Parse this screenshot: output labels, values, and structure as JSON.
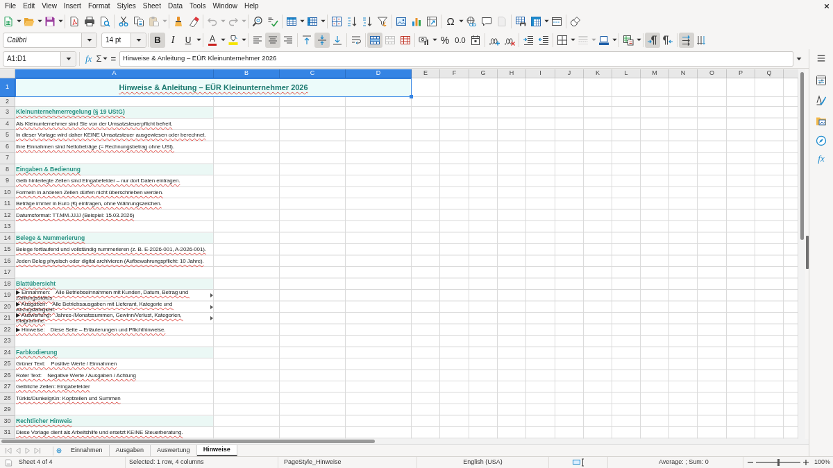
{
  "menu_bar": {
    "items": [
      "File",
      "Edit",
      "View",
      "Insert",
      "Format",
      "Styles",
      "Sheet",
      "Data",
      "Tools",
      "Window",
      "Help"
    ]
  },
  "standard_toolbar": {
    "buttons": [
      {
        "disabled": false
      },
      {
        "disabled": false
      },
      {
        "disabled": false
      },
      {
        "disabled": false
      },
      {
        "disabled": false
      },
      {
        "disabled": false
      },
      {
        "disabled": false
      },
      {
        "disabled": false
      },
      {
        "disabled": true
      },
      {
        "disabled": false
      },
      {
        "disabled": false
      },
      {
        "disabled": true
      },
      {
        "disabled": true
      },
      {
        "disabled": false
      },
      {
        "disabled": false
      },
      {
        "disabled": false
      },
      {
        "disabled": false
      },
      {
        "disabled": false
      },
      {
        "disabled": false
      },
      {
        "disabled": false
      },
      {
        "disabled": false
      },
      {
        "disabled": false
      },
      {
        "disabled": false
      },
      {
        "disabled": false
      },
      {
        "label": "Ω",
        "disabled": false
      },
      {
        "disabled": false
      },
      {
        "disabled": false
      },
      {
        "disabled": true
      },
      {
        "disabled": false
      },
      {
        "disabled": false
      },
      {
        "disabled": false
      },
      {
        "disabled": false
      }
    ]
  },
  "formatting_toolbar": {
    "font_name": "Calibri",
    "font_size": "14 pt",
    "buttons": [
      {
        "label": "B",
        "pressed": true,
        "disabled": false
      },
      {
        "label": "I",
        "pressed": false,
        "disabled": false
      },
      {
        "label": "U",
        "pressed": false,
        "disabled": false
      },
      {
        "label": "A",
        "pressed": false,
        "disabled": false
      },
      {
        "pressed": false,
        "disabled": false
      },
      {
        "pressed": false,
        "disabled": false
      },
      {
        "pressed": true,
        "disabled": false
      },
      {
        "pressed": false,
        "disabled": false
      },
      {
        "pressed": false,
        "disabled": false
      },
      {
        "pressed": true,
        "disabled": false
      },
      {
        "pressed": false,
        "disabled": false
      },
      {
        "pressed": false,
        "disabled": false
      },
      {
        "pressed": true,
        "disabled": false
      },
      {
        "pressed": false,
        "disabled": true
      },
      {
        "pressed": false,
        "disabled": false
      },
      {
        "pressed": false,
        "disabled": false
      },
      {
        "label": "%",
        "pressed": false,
        "disabled": false
      },
      {
        "label": "0.0",
        "pressed": false,
        "disabled": false
      },
      {
        "pressed": false,
        "disabled": false
      },
      {
        "pressed": false,
        "disabled": false
      },
      {
        "pressed": false,
        "disabled": false
      },
      {
        "pressed": false,
        "disabled": false
      },
      {
        "pressed": false,
        "disabled": false
      },
      {
        "pressed": false,
        "disabled": false
      },
      {
        "pressed": false,
        "disabled": true
      },
      {
        "pressed": false,
        "disabled": false
      },
      {
        "pressed": false,
        "disabled": false
      },
      {
        "pressed": true,
        "disabled": false
      },
      {
        "pressed": false,
        "disabled": false
      },
      {
        "pressed": true,
        "disabled": false
      },
      {
        "pressed": false,
        "disabled": false
      }
    ]
  },
  "formula_bar": {
    "name_box": "A1:D1",
    "function_wizard": "fx",
    "sum": "Σ",
    "equals": "=",
    "content": "Hinweise & Anleitung – EÜR Kleinunternehmer 2026"
  },
  "sheet": {
    "columns": [
      {
        "label": "A",
        "selected": true
      },
      {
        "label": "B",
        "selected": true
      },
      {
        "label": "C",
        "selected": true
      },
      {
        "label": "D",
        "selected": true
      },
      {
        "label": "E",
        "selected": false
      },
      {
        "label": "F",
        "selected": false
      },
      {
        "label": "G",
        "selected": false
      },
      {
        "label": "H",
        "selected": false
      },
      {
        "label": "I",
        "selected": false
      },
      {
        "label": "J",
        "selected": false
      },
      {
        "label": "K",
        "selected": false
      },
      {
        "label": "L",
        "selected": false
      },
      {
        "label": "M",
        "selected": false
      },
      {
        "label": "N",
        "selected": false
      },
      {
        "label": "O",
        "selected": false
      },
      {
        "label": "P",
        "selected": false
      },
      {
        "label": "Q",
        "selected": false
      }
    ],
    "rows": [
      {
        "number": "1",
        "selected": true,
        "kind": "title",
        "text": "Hinweise & Anleitung – EÜR Kleinunternehmer 2026"
      },
      {
        "number": "2",
        "selected": false,
        "kind": "empty"
      },
      {
        "number": "3",
        "selected": false,
        "kind": "heading",
        "text": "Kleinunternehmerregelung (§ 19 UStG)",
        "clipped": false
      },
      {
        "number": "4",
        "selected": false,
        "kind": "text",
        "text": "Als Kleinunternehmer sind Sie von der Umsatzsteuerpflicht befreit.",
        "clipped": false
      },
      {
        "number": "5",
        "selected": false,
        "kind": "text",
        "text": "In dieser Vorlage wird daher KEINE Umsatzsteuer ausgewiesen oder berechnet.",
        "clipped": false
      },
      {
        "number": "6",
        "selected": false,
        "kind": "text",
        "text": "Ihre Einnahmen sind Nettobeträge (= Rechnungsbetrag ohne USt).",
        "clipped": false
      },
      {
        "number": "7",
        "selected": false,
        "kind": "empty"
      },
      {
        "number": "8",
        "selected": false,
        "kind": "heading",
        "text": "Eingaben & Bedienung",
        "clipped": false
      },
      {
        "number": "9",
        "selected": false,
        "kind": "text",
        "text": "Gelb hinterlegte Zellen sind Eingabefelder – nur dort Daten eintragen.",
        "clipped": false
      },
      {
        "number": "10",
        "selected": false,
        "kind": "text",
        "text": "Formeln in anderen Zellen dürfen nicht überschrieben werden.",
        "clipped": false
      },
      {
        "number": "11",
        "selected": false,
        "kind": "text",
        "text": "Beträge immer in Euro (€) eintragen, ohne Währungszeichen.",
        "clipped": false
      },
      {
        "number": "12",
        "selected": false,
        "kind": "text",
        "text": "Datumsformat: TT.MM.JJJJ (Beispiel: 15.03.2026)",
        "clipped": false
      },
      {
        "number": "13",
        "selected": false,
        "kind": "empty"
      },
      {
        "number": "14",
        "selected": false,
        "kind": "heading",
        "text": "Belege & Nummerierung",
        "clipped": false
      },
      {
        "number": "15",
        "selected": false,
        "kind": "text",
        "text": "Belege fortlaufend und vollständig nummerieren (z. B. E-2026-001, A-2026-001).",
        "clipped": false
      },
      {
        "number": "16",
        "selected": false,
        "kind": "text",
        "text": "Jeden Beleg physisch oder digital archivieren (Aufbewahrungspflicht: 10 Jahre).",
        "clipped": false
      },
      {
        "number": "17",
        "selected": false,
        "kind": "empty"
      },
      {
        "number": "18",
        "selected": false,
        "kind": "heading",
        "text": "Blattübersicht",
        "clipped": false
      },
      {
        "number": "19",
        "selected": false,
        "kind": "text",
        "text": "▶ Einnahmen:    Alle Betriebseinnahmen mit Kunden, Datum, Betrag und Zahlungsstatus.",
        "clipped": true
      },
      {
        "number": "20",
        "selected": false,
        "kind": "text",
        "text": "▶ Ausgaben:    Alle Betriebsausgaben mit Lieferant, Kategorie und Abzugsfähigkeit.",
        "clipped": true
      },
      {
        "number": "21",
        "selected": false,
        "kind": "text",
        "text": "▶ Auswertung:   Jahres-/Monatssummen, Gewinn/Verlust, Kategorien, Diagramme.",
        "clipped": true
      },
      {
        "number": "22",
        "selected": false,
        "kind": "text",
        "text": "▶ Hinweise:    Diese Seite – Erläuterungen und Pflichthinweise.",
        "clipped": false
      },
      {
        "number": "23",
        "selected": false,
        "kind": "empty"
      },
      {
        "number": "24",
        "selected": false,
        "kind": "heading",
        "text": "Farbkodierung",
        "clipped": false
      },
      {
        "number": "25",
        "selected": false,
        "kind": "text",
        "text": "Grüner Text:    Positive Werte / Einnahmen",
        "clipped": false
      },
      {
        "number": "26",
        "selected": false,
        "kind": "text",
        "text": "Roter Text:    Negative Werte / Ausgaben / Achtung",
        "clipped": false
      },
      {
        "number": "27",
        "selected": false,
        "kind": "text",
        "text": "Gelbliche Zellen: Eingabefelder",
        "clipped": false
      },
      {
        "number": "28",
        "selected": false,
        "kind": "text",
        "text": "Türkis/Dunkelgrün: Kopfzeilen und Summen",
        "clipped": false
      },
      {
        "number": "29",
        "selected": false,
        "kind": "empty"
      },
      {
        "number": "30",
        "selected": false,
        "kind": "heading",
        "text": "Rechtlicher Hinweis",
        "clipped": false
      },
      {
        "number": "31",
        "selected": false,
        "kind": "text",
        "text": "Diese Vorlage dient als Arbeitshilfe und ersetzt KEINE Steuerberatung.",
        "clipped": false
      }
    ]
  },
  "sidebar": {
    "functions_label": "fx"
  },
  "sheet_tabs": {
    "navigation": [
      {
        "disabled": true
      },
      {
        "disabled": true
      },
      {
        "disabled": true
      },
      {
        "disabled": true
      }
    ],
    "tabs": [
      {
        "label": "Einnahmen",
        "selected": false
      },
      {
        "label": "Ausgaben",
        "selected": false
      },
      {
        "label": "Auswertung",
        "selected": false
      },
      {
        "label": "Hinweise",
        "selected": true
      }
    ]
  },
  "status_bar": {
    "sheet_position": "Sheet 4 of 4",
    "selection": "Selected: 1 row, 4 columns",
    "page_style": "PageStyle_Hinweise",
    "language": "English (USA)",
    "summary": "Average: ; Sum: 0",
    "zoom": {
      "level": 0.5,
      "label": "100%"
    }
  }
}
